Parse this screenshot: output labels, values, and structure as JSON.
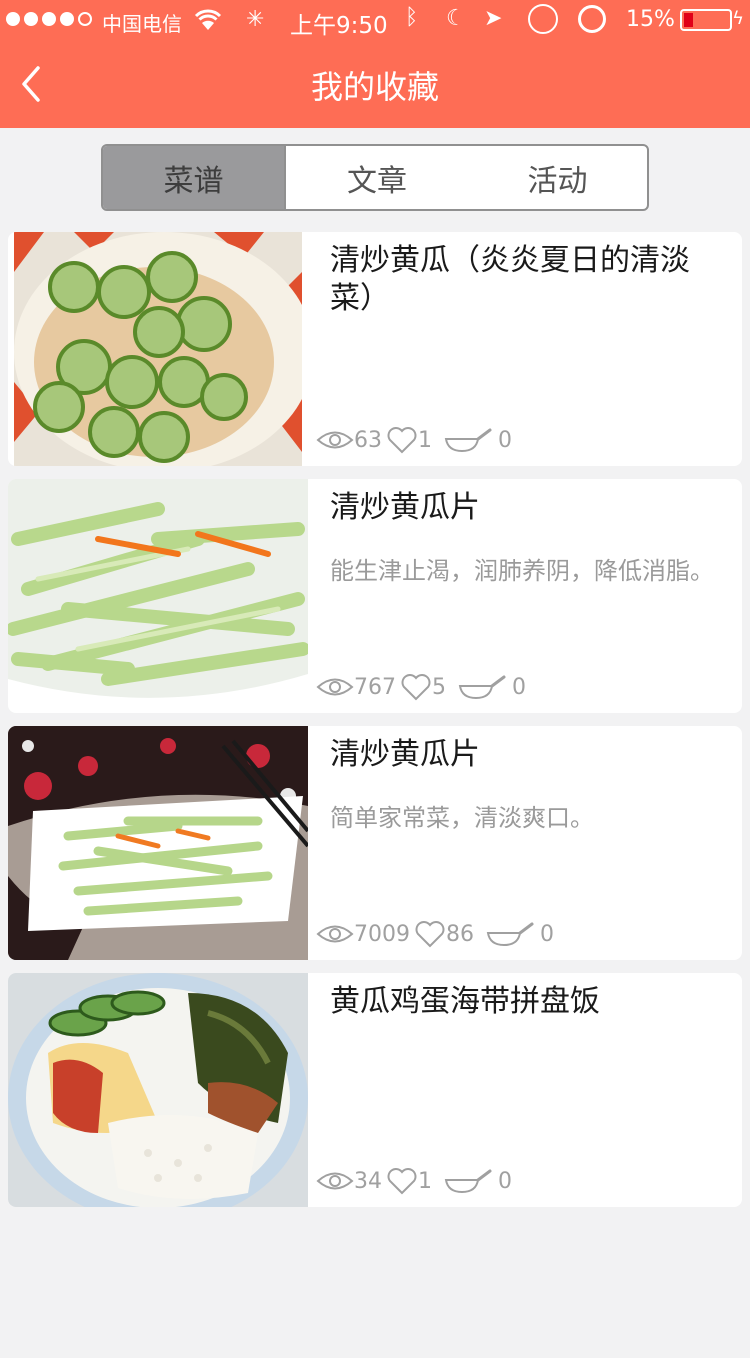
{
  "status_bar": {
    "carrier": "中国电信",
    "time": "上午9:50",
    "battery": "15%"
  },
  "nav": {
    "title": "我的收藏"
  },
  "tabs": [
    {
      "label": "菜谱",
      "active": true
    },
    {
      "label": "文章",
      "active": false
    },
    {
      "label": "活动",
      "active": false
    }
  ],
  "recipes": [
    {
      "title": "清炒黄瓜（炎炎夏日的清淡菜）",
      "desc": "",
      "views": "63",
      "likes": "1",
      "cooked": "0"
    },
    {
      "title": "清炒黄瓜片",
      "desc": "能生津止渴，润肺养阴，降低消脂。",
      "views": "767",
      "likes": "5",
      "cooked": "0"
    },
    {
      "title": "清炒黄瓜片",
      "desc": "简单家常菜，清淡爽口。",
      "views": "7009",
      "likes": "86",
      "cooked": "0"
    },
    {
      "title": "黄瓜鸡蛋海带拼盘饭",
      "desc": "",
      "views": "34",
      "likes": "1",
      "cooked": "0"
    }
  ],
  "colors": {
    "accent": "#fe6d55",
    "background": "#f2f2f3",
    "tab_active": "#9a9a9c"
  }
}
